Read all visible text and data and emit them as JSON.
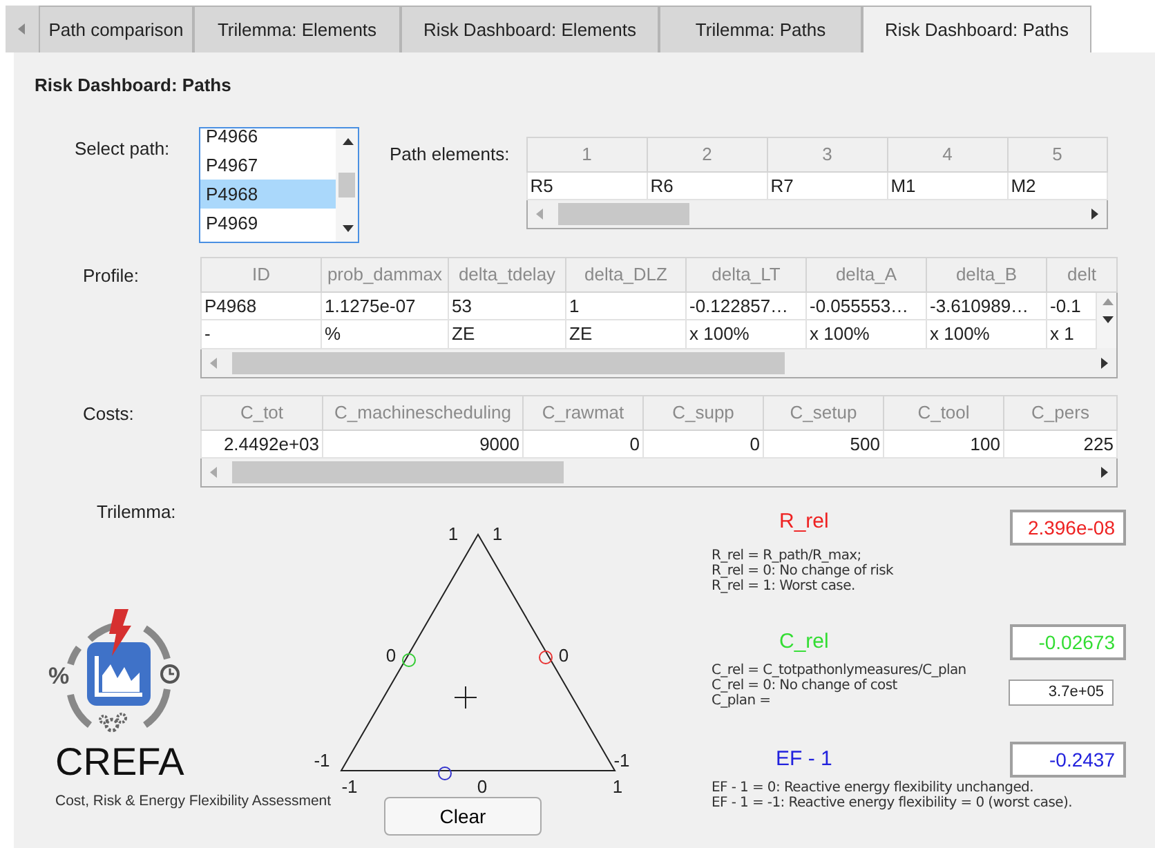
{
  "tabs": [
    {
      "label": "Path comparison",
      "selected": false
    },
    {
      "label": "Trilemma: Elements",
      "selected": false
    },
    {
      "label": "Risk Dashboard: Elements",
      "selected": false
    },
    {
      "label": "Trilemma: Paths",
      "selected": false
    },
    {
      "label": "Risk Dashboard: Paths",
      "selected": true
    }
  ],
  "heading": "Risk Dashboard: Paths",
  "path_selector": {
    "label": "Select path:",
    "items": [
      {
        "label": "P4966",
        "selected": false
      },
      {
        "label": "P4967",
        "selected": false
      },
      {
        "label": "P4968",
        "selected": true
      },
      {
        "label": "P4969",
        "selected": false
      }
    ]
  },
  "path_elements": {
    "label": "Path elements:",
    "columns": [
      "1",
      "2",
      "3",
      "4",
      "5"
    ],
    "rows": [
      [
        "R5",
        "R6",
        "R7",
        "M1",
        "M2"
      ]
    ]
  },
  "profile": {
    "label": "Profile:",
    "columns": [
      "ID",
      "prob_dammax",
      "delta_tdelay",
      "delta_DLZ",
      "delta_LT",
      "delta_A",
      "delta_B",
      "delt"
    ],
    "rows": [
      [
        "P4968",
        "1.1275e-07",
        "53",
        "1",
        "-0.122857…",
        "-0.055553…",
        "-3.610989…",
        "-0.1"
      ],
      [
        "-",
        "%",
        "ZE",
        "ZE",
        "x 100%",
        "x 100%",
        "x 100%",
        "x 1"
      ]
    ]
  },
  "costs": {
    "label": "Costs:",
    "columns": [
      "C_tot",
      "C_machinescheduling",
      "C_rawmat",
      "C_supp",
      "C_setup",
      "C_tool",
      "C_pers"
    ],
    "rows": [
      [
        "2.4492e+03",
        "9000",
        "0",
        "0",
        "500",
        "100",
        "225"
      ]
    ]
  },
  "trilemma": {
    "label": "Trilemma:",
    "axis_labels": [
      "1",
      "1",
      "0",
      "0",
      "-1",
      "-1",
      "-1",
      "0",
      "1"
    ],
    "markers": [
      {
        "color": "#33cc33"
      },
      {
        "color": "#e83333"
      },
      {
        "color": "#3333cc"
      }
    ],
    "button": "Clear"
  },
  "logo": {
    "symbol": "%",
    "title": "CREFA",
    "subtitle": "Cost, Risk & Energy Flexibility Assessment"
  },
  "metrics": [
    {
      "name": "R_rel",
      "color": "#ee2222",
      "value": "2.396e-08",
      "description": [
        "R_rel = R_path/R_max;",
        "R_rel = 0: No change of risk",
        "R_rel = 1: Worst case."
      ]
    },
    {
      "name": "C_rel",
      "color": "#33dd33",
      "value": "-0.02673",
      "description": [
        "C_rel = C_totpathonlymeasures/C_plan",
        "C_rel =  0: No change of cost"
      ],
      "sub_field": {
        "label": "C_plan =",
        "value": "3.7e+05"
      }
    },
    {
      "name": "EF - 1",
      "color": "#2222dd",
      "value": "-0.2437",
      "description": [
        "EF - 1 = 0: Reactive energy flexibility unchanged.",
        "EF - 1 = -1: Reactive energy flexibility = 0 (worst case)."
      ]
    }
  ]
}
